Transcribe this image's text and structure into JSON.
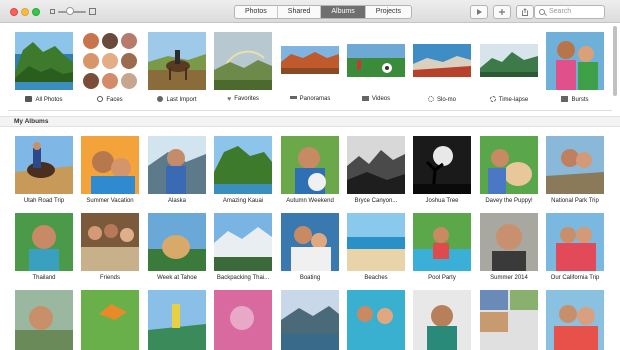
{
  "toolbar": {
    "tabs": [
      {
        "label": "Photos"
      },
      {
        "label": "Shared"
      },
      {
        "label": "Albums"
      },
      {
        "label": "Projects"
      }
    ],
    "selected_tab": "Albums",
    "search_placeholder": "Search"
  },
  "top_albums": [
    {
      "label": "All Photos",
      "icon": "photos-icon"
    },
    {
      "label": "Faces",
      "icon": "face-icon"
    },
    {
      "label": "Last Import",
      "icon": "import-icon"
    },
    {
      "label": "Favorites",
      "icon": "heart-icon"
    },
    {
      "label": "Panoramas",
      "icon": "panorama-icon"
    },
    {
      "label": "Videos",
      "icon": "video-icon"
    },
    {
      "label": "Slo-mo",
      "icon": "slomo-icon"
    },
    {
      "label": "Time-lapse",
      "icon": "timelapse-icon"
    },
    {
      "label": "Bursts",
      "icon": "burst-icon"
    }
  ],
  "my_albums": {
    "title": "My Albums",
    "rows": [
      [
        "Utah Road Trip",
        "Summer Vacation",
        "Alaska",
        "Amazing Kauai",
        "Autumn Weekend",
        "Bryce Canyon...",
        "Joshua Tree",
        "Davey the Puppy!",
        "National Park Trip"
      ],
      [
        "Thailand",
        "Friends",
        "Week at Tahoe",
        "Backpacking Thai...",
        "Boating",
        "Beaches",
        "Pool Party",
        "Summer 2014",
        "Our California Trip"
      ]
    ]
  },
  "colors": {
    "selected_tab_bg": "#6f6f6f",
    "section_bg": "#f3f3f3"
  }
}
